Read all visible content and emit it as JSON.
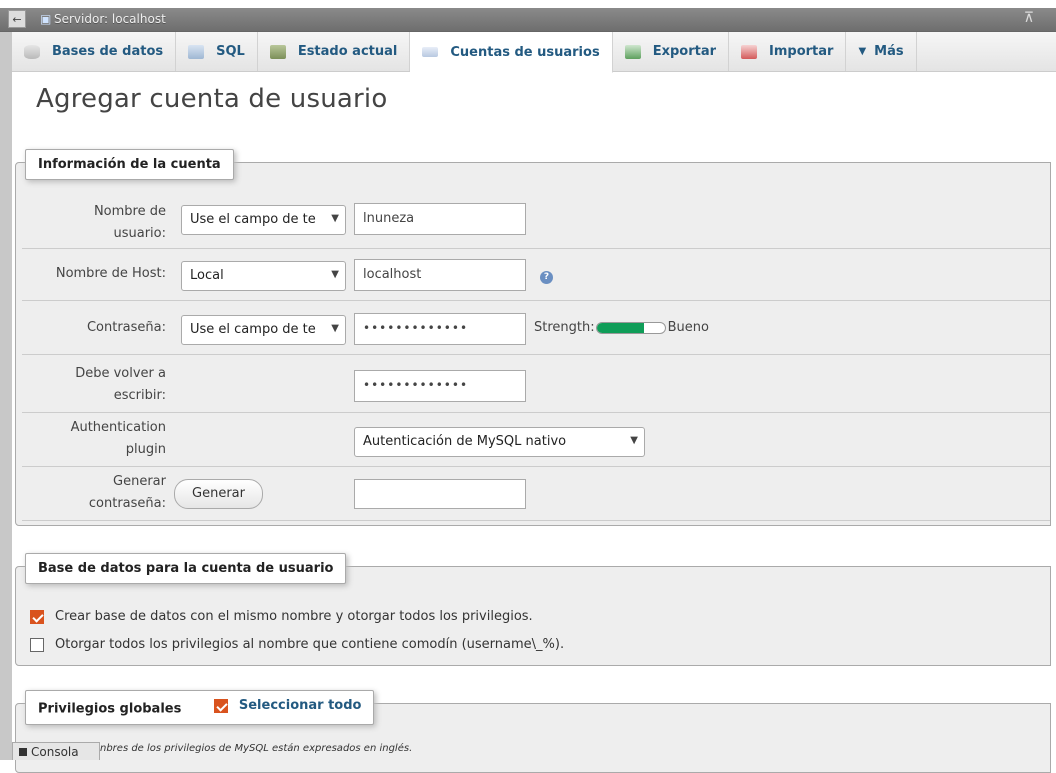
{
  "topbar": {
    "server_title": "Servidor: localhost",
    "back_icon": "arrow-left-icon",
    "collapse_icon": "collapse-up-icon"
  },
  "tabs": [
    {
      "label": "Bases de datos",
      "icon": "database-icon"
    },
    {
      "label": "SQL",
      "icon": "sql-icon"
    },
    {
      "label": "Estado actual",
      "icon": "status-icon"
    },
    {
      "label": "Cuentas de usuarios",
      "icon": "users-icon",
      "active": true
    },
    {
      "label": "Exportar",
      "icon": "export-icon"
    },
    {
      "label": "Importar",
      "icon": "import-icon"
    },
    {
      "label": "Más",
      "icon": "caret-down-icon"
    }
  ],
  "page_title": "Agregar cuenta de usuario",
  "account_info": {
    "legend": "Información de la cuenta",
    "username": {
      "label_line1": "Nombre de",
      "label_line2": "usuario:",
      "select_value": "Use el campo de te",
      "value": "lnuneza"
    },
    "host": {
      "label": "Nombre de Host:",
      "select_value": "Local",
      "value": "localhost"
    },
    "password": {
      "label": "Contraseña:",
      "select_value": "Use el campo de te",
      "value": "•••••••••••••",
      "strength_label": "Strength:",
      "strength_text": "Bueno",
      "strength_fraction": 0.7
    },
    "retype": {
      "label_line1": "Debe volver a",
      "label_line2": "escribir:",
      "value": "•••••••••••••"
    },
    "auth": {
      "label_line1": "Authentication",
      "label_line2": "plugin",
      "select_value": "Autenticación de MySQL nativo"
    },
    "generate": {
      "label_line1": "Generar",
      "label_line2": "contraseña:",
      "button": "Generar",
      "value": ""
    }
  },
  "database_section": {
    "legend": "Base de datos para la cuenta de usuario",
    "options": [
      {
        "label": "Crear base de datos con el mismo nombre y otorgar todos los privilegios.",
        "checked": true
      },
      {
        "label": "Otorgar todos los privilegios al nombre que contiene comodín (username\\_%).",
        "checked": false
      }
    ]
  },
  "global_privileges": {
    "legend": "Privilegios globales",
    "select_all": "Seleccionar todo",
    "select_all_checked": true,
    "note": "nbres de los privilegios de MySQL están expresados en inglés."
  },
  "console": {
    "label": "Consola"
  },
  "colors": {
    "accent": "#235a81",
    "checkbox_on": "#d9531e",
    "strength_fill": "#0f9d58"
  }
}
